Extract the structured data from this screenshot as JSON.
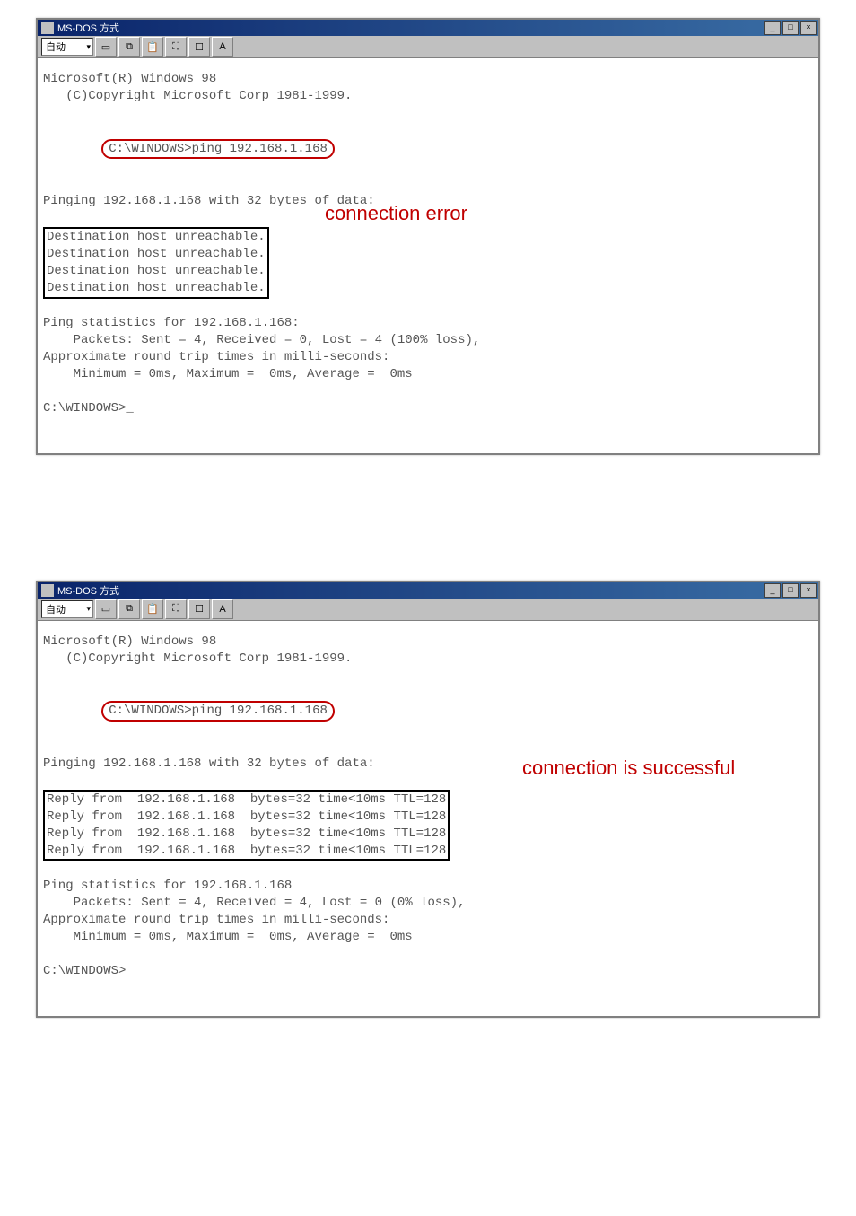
{
  "window1": {
    "title": "MS-DOS 方式",
    "toolbar_select": "自动",
    "header_line1": "Microsoft(R) Windows 98",
    "header_line2": "   (C)Copyright Microsoft Corp 1981-1999.",
    "prompt_cmd_prefix": "C:\\WINDOWS>",
    "cmd": "ping 192.168.1.168",
    "pinging": "Pinging 192.168.1.168 with 32 bytes of data:",
    "replies": [
      "Destination host unreachable.",
      "Destination host unreachable.",
      "Destination host unreachable.",
      "Destination host unreachable."
    ],
    "stats_header": "Ping statistics for 192.168.1.168:",
    "stats_packets": "    Packets: Sent = 4, Received = 0, Lost = 4 (100% loss),",
    "stats_rtt": "Approximate round trip times in milli-seconds:",
    "stats_vals": "    Minimum = 0ms, Maximum =  0ms, Average =  0ms",
    "final_prompt": "C:\\WINDOWS>_",
    "annotation": "connection error"
  },
  "window2": {
    "title": "MS-DOS 方式",
    "toolbar_select": "自动",
    "header_line1": "Microsoft(R) Windows 98",
    "header_line2": "   (C)Copyright Microsoft Corp 1981-1999.",
    "prompt_cmd_prefix": "C:\\WINDOWS>",
    "cmd": "ping 192.168.1.168",
    "pinging": "Pinging 192.168.1.168 with 32 bytes of data:",
    "replies": [
      "Reply from  192.168.1.168  bytes=32 time<10ms TTL=128",
      "Reply from  192.168.1.168  bytes=32 time<10ms TTL=128",
      "Reply from  192.168.1.168  bytes=32 time<10ms TTL=128",
      "Reply from  192.168.1.168  bytes=32 time<10ms TTL=128"
    ],
    "stats_header": "Ping statistics for 192.168.1.168",
    "stats_packets": "    Packets: Sent = 4, Received = 4, Lost = 0 (0% loss),",
    "stats_rtt": "Approximate round trip times in milli-seconds:",
    "stats_vals": "    Minimum = 0ms, Maximum =  0ms, Average =  0ms",
    "final_prompt": "C:\\WINDOWS>",
    "annotation": "connection is\nsuccessful"
  },
  "icons": {
    "copy": "⧉",
    "paste": "📋",
    "fullscreen": "⛶",
    "props": "☐",
    "font": "A",
    "mark": "▭"
  },
  "winbtn": {
    "min": "_",
    "max": "□",
    "close": "×"
  }
}
